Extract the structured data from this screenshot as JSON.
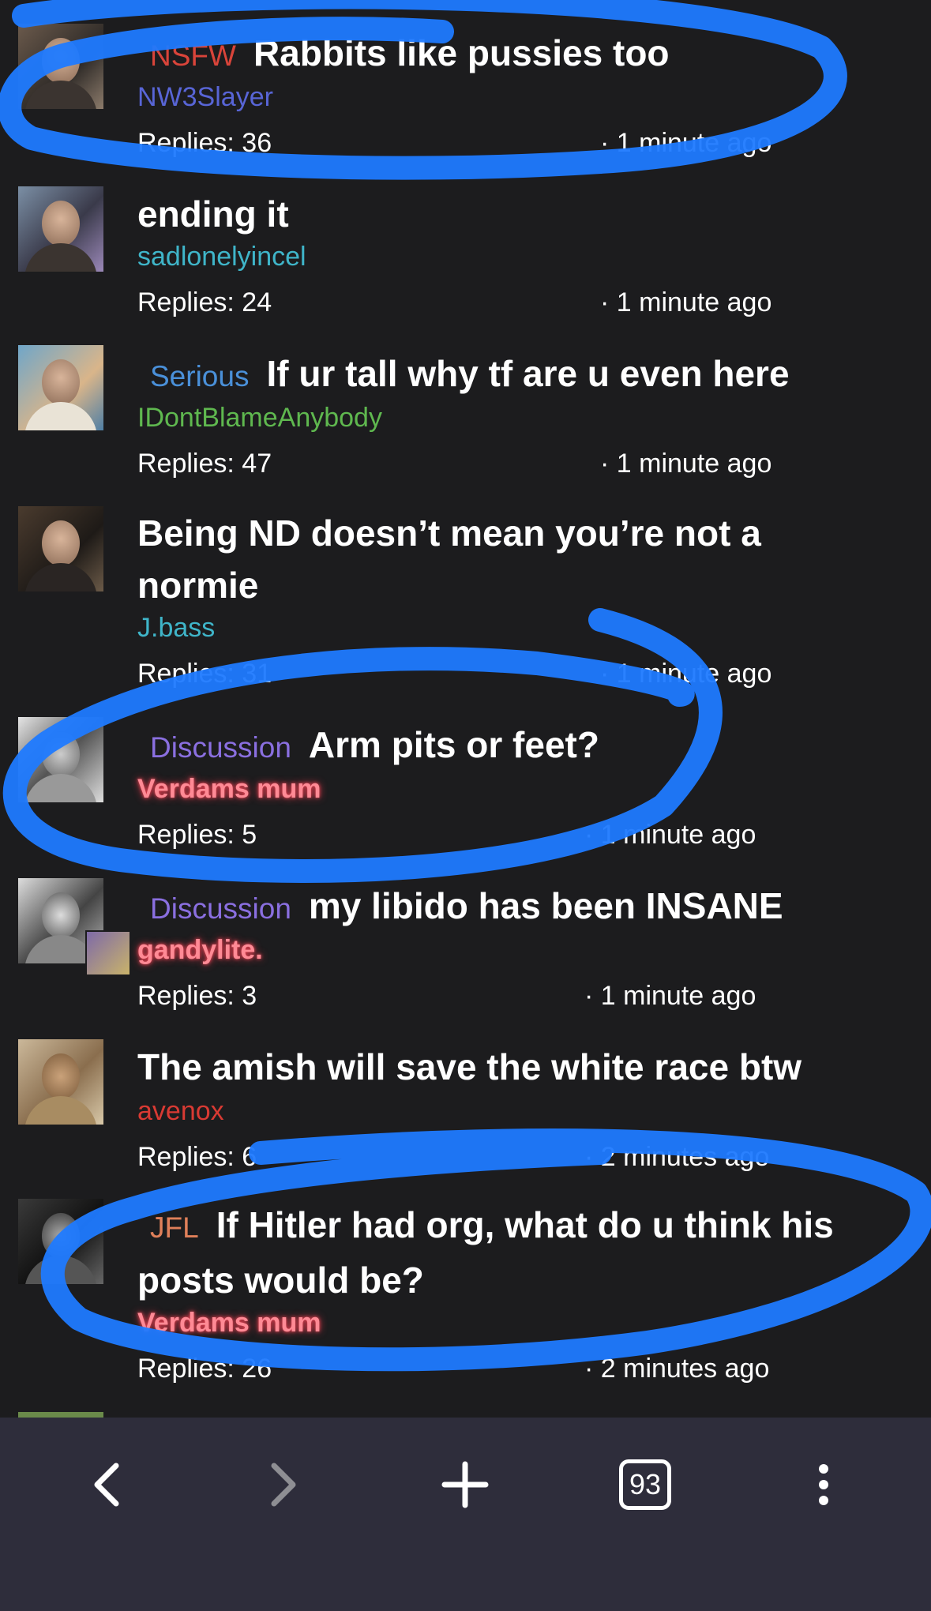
{
  "threads": [
    {
      "tag": "NSFW",
      "tag_color": "#d9443a",
      "title": "Rabbits like pussies too",
      "user": "NW3Slayer",
      "user_color": "#5865d6",
      "replies": "Replies: 36",
      "time": "· 1 minute ago"
    },
    {
      "tag": "",
      "tag_color": "",
      "title": "ending it",
      "user": "sadlonelyincel",
      "user_color": "#3fb5c9",
      "replies": "Replies: 24",
      "time": "· 1 minute ago"
    },
    {
      "tag": "Serious",
      "tag_color": "#4a90d9",
      "title": "If ur tall why tf are u even here",
      "user": "IDontBlameAnybody",
      "user_color": "#5fb84f",
      "replies": "Replies: 47",
      "time": "· 1 minute ago"
    },
    {
      "tag": "",
      "tag_color": "",
      "title": "Being ND doesn’t mean you’re not a normie",
      "user": "J.bass",
      "user_color": "#3fb5c9",
      "replies": "Replies: 31",
      "time": "· 1 minute ago"
    },
    {
      "tag": "Discussion",
      "tag_color": "#8a6fe0",
      "title": "Arm pits or feet?",
      "user": "Verdams mum",
      "user_color": "#ff5a6a",
      "replies": "Replies: 5",
      "time": "· 1 minute ago"
    },
    {
      "tag": "Discussion",
      "tag_color": "#8a6fe0",
      "title": "my libido has been INSANE",
      "user": "gandylite.",
      "user_color": "#ff5a6a",
      "replies": "Replies: 3",
      "time": "· 1 minute ago"
    },
    {
      "tag": "",
      "tag_color": "",
      "title": "The amish will save the white race btw",
      "user": "avenox",
      "user_color": "#d93a33",
      "replies": "Replies: 6",
      "time": "· 2 minutes ago"
    },
    {
      "tag": "JFL",
      "tag_color": "#e0805a",
      "title": "If Hitler had org, what do u think his posts would be?",
      "user": "Verdams mum",
      "user_color": "#ff5a6a",
      "replies": "Replies: 26",
      "time": "· 2 minutes ago"
    }
  ],
  "bottom_nav": {
    "back_icon": "chevron-left-icon",
    "forward_icon": "chevron-right-icon",
    "new_tab_icon": "plus-icon",
    "tab_count": "93",
    "menu_icon": "vertical-dots-icon"
  },
  "annotation_color": "#1f7aff"
}
